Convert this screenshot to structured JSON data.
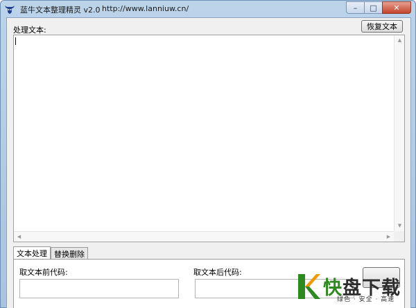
{
  "window": {
    "title": "蓝牛文本整理精灵 v2.0",
    "url": "http://www.lanniuw.cn/",
    "controls": {
      "minimize": "–",
      "maximize": "□",
      "close": "✕"
    }
  },
  "main": {
    "process_label": "处理文本:",
    "restore_button": "恢复文本",
    "text_content": ""
  },
  "tabs": [
    {
      "label": "文本处理",
      "active": true
    },
    {
      "label": "替换删除",
      "active": false
    }
  ],
  "panel": {
    "prefix_label": "取文本前代码:",
    "suffix_label": "取文本后代码:",
    "prefix_value": "",
    "suffix_value": "",
    "action_button": ""
  },
  "watermark": {
    "brand_highlight": "快",
    "brand_rest": "盘下载",
    "tagline": "绿色 · 安全 · 高速"
  },
  "colors": {
    "titlebar": "#bcd4ea",
    "close": "#c5432b",
    "watermark_green": "#2c8a1f",
    "watermark_orange": "#f39800"
  }
}
